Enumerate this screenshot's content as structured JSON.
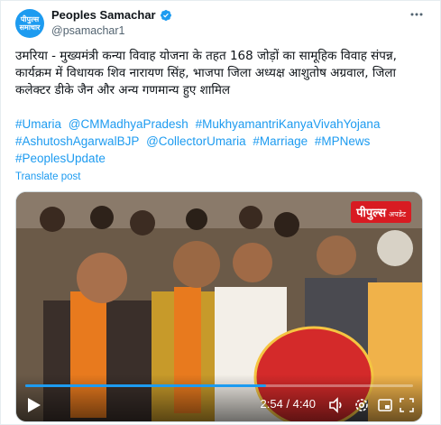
{
  "account": {
    "display_name": "Peoples Samachar",
    "handle": "@psamachar1",
    "avatar_text": "पीपुल्स समाचार",
    "verified_icon": "verified-badge-icon"
  },
  "tweet": {
    "text": "उमरिया - मुख्यमंत्री कन्या विवाह योजना के तहत 168 जोड़ों का सामूहिक विवाह संपन्न, कार्यक्रम में विधायक शिव नारायण सिंह, भाजपा जिला अध्यक्ष आशुतोष अग्रवाल, जिला कलेक्टर डीके जैन और अन्य गणमान्य हुए शामिल",
    "hashtags": [
      "#Umaria",
      "@CMMadhyaPradesh",
      "#MukhyamantriKanyaVivahYojana",
      "#AshutoshAgarwalBJP",
      "@CollectorUmaria",
      "#Marriage",
      "#MPNews",
      "#PeoplesUpdate"
    ],
    "translate_label": "Translate post"
  },
  "video": {
    "watermark_main": "पीपुल्स",
    "watermark_sub": "अपडेट",
    "timecode": "2:54 / 4:40",
    "progress": 0.62,
    "accent_color": "#1d9bf0"
  },
  "menu": {
    "more_icon": "more-options-icon"
  }
}
